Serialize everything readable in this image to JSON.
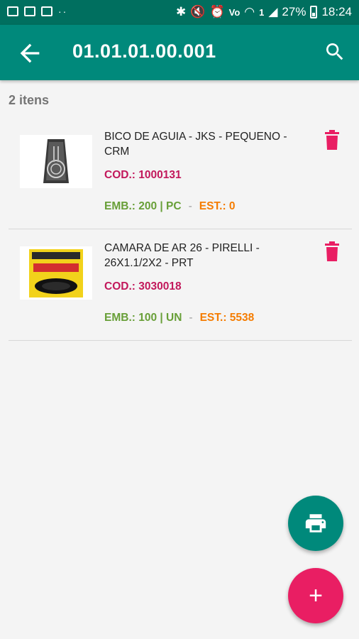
{
  "status_bar": {
    "battery": "27%",
    "time": "18:24"
  },
  "appbar": {
    "title": "01.01.01.00.001"
  },
  "list": {
    "count_label": "2 itens",
    "items": [
      {
        "name": "BICO DE AGUIA - JKS - PEQUENO - CRM",
        "code": "COD.: 1000131",
        "emb": "EMB.: 200 | PC",
        "sep": "-",
        "est": "EST.: 0"
      },
      {
        "name": "CAMARA DE AR 26 - PIRELLI - 26X1.1/2X2 - PRT",
        "code": "COD.: 3030018",
        "emb": "EMB.: 100 | UN",
        "sep": "-",
        "est": "EST.: 5538"
      }
    ]
  },
  "fab": {
    "add_label": "+"
  },
  "colors": {
    "primary": "#00897b",
    "primary_dark": "#006f5f",
    "accent": "#e91e63",
    "code": "#c2185b",
    "emb": "#689f38",
    "est": "#f57c00"
  },
  "icons": [
    "arrow-left-icon",
    "search-icon",
    "trash-icon",
    "printer-icon",
    "plus-icon"
  ]
}
